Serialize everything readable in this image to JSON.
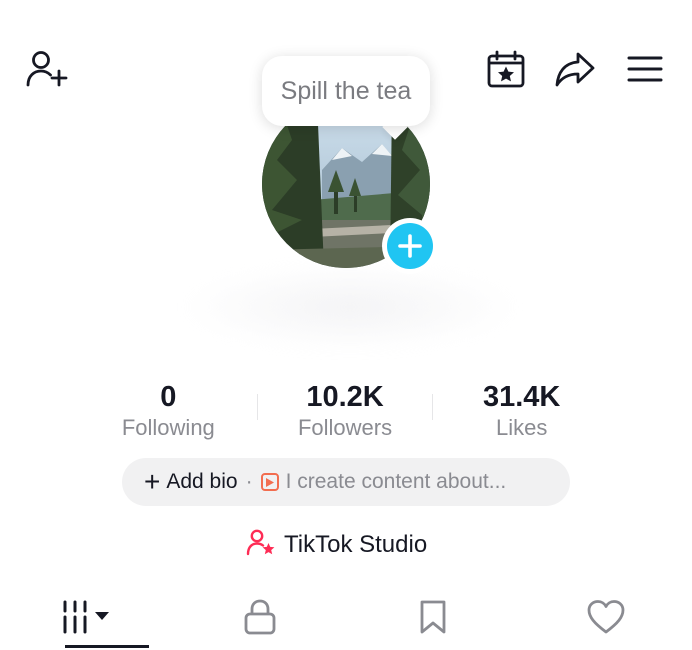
{
  "header": {
    "left_icon": "add-friend-icon",
    "right_icons": [
      "calendar-star-icon",
      "share-icon",
      "menu-icon"
    ]
  },
  "tooltip": {
    "text": "Spill the tea"
  },
  "avatar": {
    "badge_icon": "plus-icon",
    "badge_color": "#20c5f2"
  },
  "stats": [
    {
      "value": "0",
      "label": "Following"
    },
    {
      "value": "10.2K",
      "label": "Followers"
    },
    {
      "value": "31.4K",
      "label": "Likes"
    }
  ],
  "bio": {
    "add_label": "Add bio",
    "separator": "·",
    "suggestion": "I create content about...",
    "suggestion_icon": "play-square-icon",
    "suggestion_icon_color": "#f26d4f"
  },
  "studio": {
    "label": "TikTok Studio",
    "icon": "person-star-icon",
    "icon_color": "#fe2c55"
  },
  "tabs": [
    {
      "icon": "grid-dropdown-icon",
      "active": true
    },
    {
      "icon": "lock-icon",
      "active": false
    },
    {
      "icon": "bookmark-icon",
      "active": false
    },
    {
      "icon": "heart-icon",
      "active": false
    }
  ]
}
